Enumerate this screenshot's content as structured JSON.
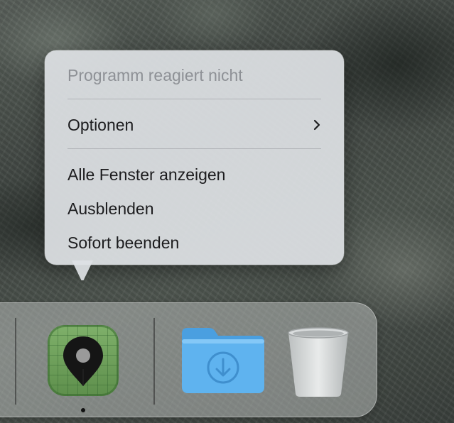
{
  "context_menu": {
    "items": [
      {
        "label": "Programm reagiert nicht",
        "enabled": false
      },
      {
        "label": "Optionen",
        "enabled": true,
        "submenu": true
      },
      {
        "label": "Alle Fenster anzeigen",
        "enabled": true
      },
      {
        "label": "Ausblenden",
        "enabled": true
      },
      {
        "label": "Sofort beenden",
        "enabled": true
      }
    ]
  },
  "dock": {
    "apps": [
      {
        "icon": "map-pin-app-icon",
        "running": true,
        "color": "#6b9e58"
      },
      {
        "icon": "downloads-folder-icon",
        "color": "#5aaee8"
      },
      {
        "icon": "trash-icon"
      }
    ]
  }
}
